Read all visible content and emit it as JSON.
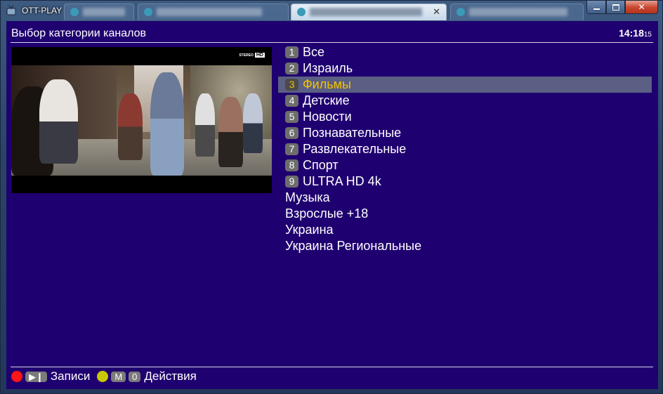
{
  "window": {
    "title": "OTT-PLAY",
    "controls": {
      "minimize_icon": "minimize-icon",
      "maximize_icon": "maximize-icon",
      "close_icon": "close-icon",
      "close_glyph": "✕"
    }
  },
  "screen": {
    "title": "Выбор категории каналов",
    "clock": {
      "time": "14:18",
      "seconds": "15"
    }
  },
  "preview": {
    "badge_small": "STEREO",
    "badge_hd": "HD"
  },
  "categories": [
    {
      "num": "1",
      "label": "Все",
      "selected": false
    },
    {
      "num": "2",
      "label": "Израиль",
      "selected": false
    },
    {
      "num": "3",
      "label": "Фильмы",
      "selected": true
    },
    {
      "num": "4",
      "label": "Детские",
      "selected": false
    },
    {
      "num": "5",
      "label": "Новости",
      "selected": false
    },
    {
      "num": "6",
      "label": "Познавательные",
      "selected": false
    },
    {
      "num": "7",
      "label": "Развлекательные",
      "selected": false
    },
    {
      "num": "8",
      "label": "Спорт",
      "selected": false
    },
    {
      "num": "9",
      "label": "ULTRA HD 4k",
      "selected": false
    },
    {
      "num": "",
      "label": "Музыка",
      "selected": false
    },
    {
      "num": "",
      "label": "Взрослые +18",
      "selected": false
    },
    {
      "num": "",
      "label": "Украина",
      "selected": false
    },
    {
      "num": "",
      "label": "Украина Региональные",
      "selected": false
    }
  ],
  "footer": {
    "play_key": "▶❙",
    "records_label": "Записи",
    "m_key": "M",
    "zero_key": "0",
    "actions_label": "Действия"
  },
  "colors": {
    "background": "#1f0070",
    "selected_row": "#5b5f83",
    "selected_text": "#f4c200",
    "red_button": "#ff1515",
    "yellow_button": "#c9c800"
  }
}
